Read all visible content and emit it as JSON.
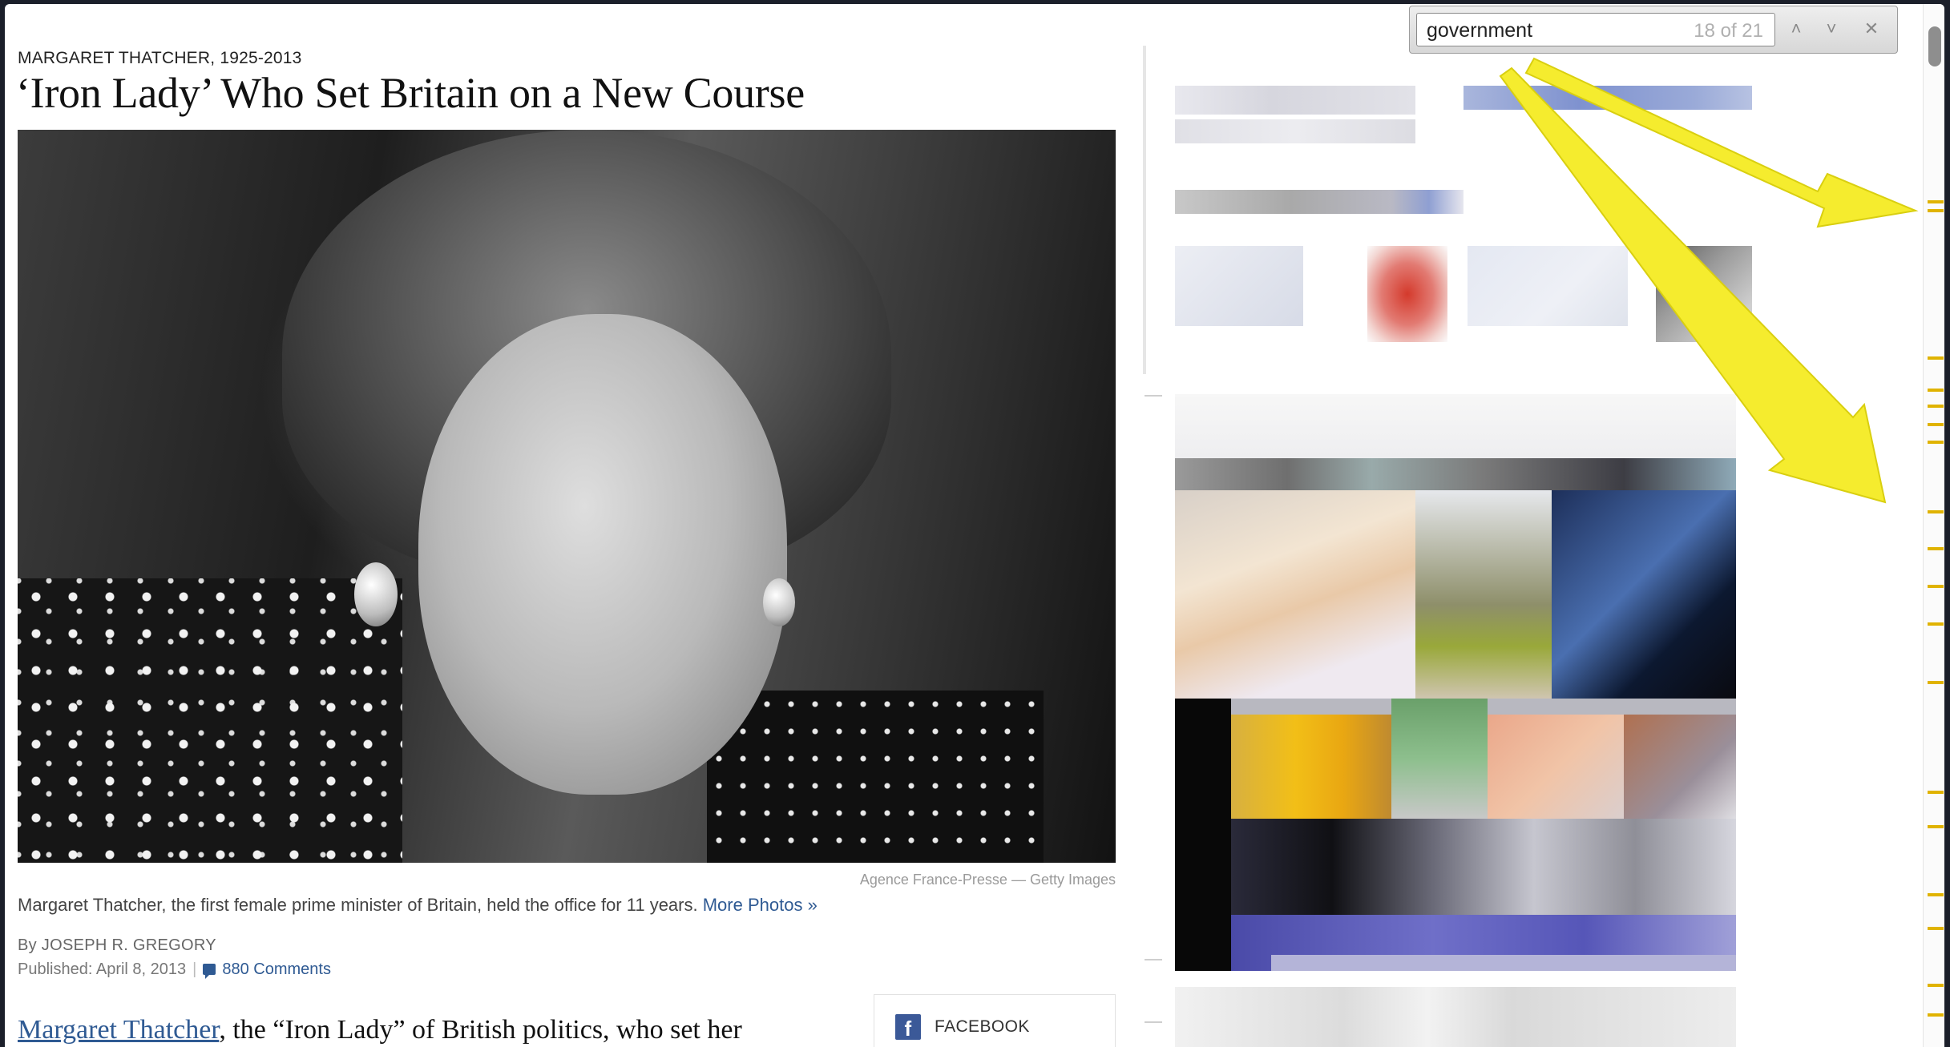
{
  "article": {
    "kicker": "MARGARET THATCHER, 1925-2013",
    "headline": "‘Iron Lady’ Who Set Britain on a New Course",
    "photo_credit": "Agence France-Presse — Getty Images",
    "caption": "Margaret Thatcher, the first female prime minister of Britain, held the office for 11 years.",
    "caption_link": "More Photos »",
    "byline": "By JOSEPH R. GREGORY",
    "published": "Published: April 8, 2013",
    "comments": "880 Comments",
    "lede_link": "Margaret Thatcher",
    "lede_rest": ", the “Iron Lady” of British politics, who set her",
    "share_facebook": "FACEBOOK",
    "facebook_glyph": "f"
  },
  "findbar": {
    "query": "government",
    "match_count": "18 of 21",
    "prev_glyph": "˄",
    "next_glyph": "˅",
    "close_glyph": "✕"
  },
  "colors": {
    "link": "#2f5a93",
    "highlight_arrow": "#f5ec2e",
    "scroll_tick": "#e0b300"
  }
}
